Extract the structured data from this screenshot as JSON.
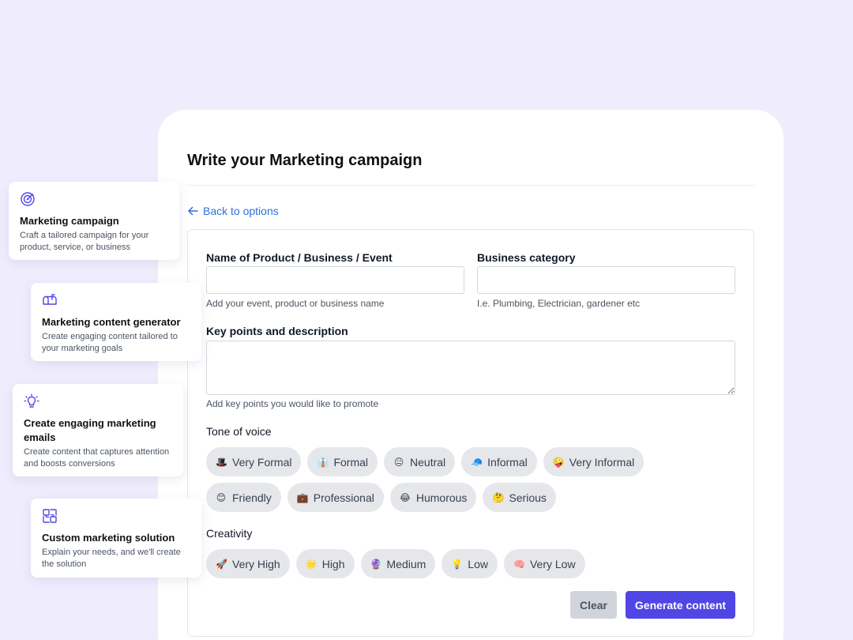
{
  "main": {
    "title": "Write your Marketing campaign",
    "back_link": "Back to options"
  },
  "form": {
    "name_field": {
      "label": "Name of Product / Business / Event",
      "value": "",
      "help": "Add your event, product or business name"
    },
    "category_field": {
      "label": "Business category",
      "value": "",
      "help": "I.e. Plumbing, Electrician, gardener etc"
    },
    "keypoints_field": {
      "label": "Key points and description",
      "value": "",
      "help": "Add key points you would like to promote"
    },
    "tone": {
      "label": "Tone of voice",
      "options": [
        {
          "emoji": "🎩",
          "label": "Very Formal"
        },
        {
          "emoji": "👔",
          "label": "Formal"
        },
        {
          "emoji": "😐",
          "label": "Neutral"
        },
        {
          "emoji": "🧢",
          "label": "Informal"
        },
        {
          "emoji": "🤪",
          "label": "Very Informal"
        },
        {
          "emoji": "😊",
          "label": "Friendly"
        },
        {
          "emoji": "💼",
          "label": "Professional"
        },
        {
          "emoji": "😂",
          "label": "Humorous"
        },
        {
          "emoji": "🤔",
          "label": "Serious"
        }
      ]
    },
    "creativity": {
      "label": "Creativity",
      "options": [
        {
          "emoji": "🚀",
          "label": "Very High"
        },
        {
          "emoji": "🌟",
          "label": "High"
        },
        {
          "emoji": "🔮",
          "label": "Medium"
        },
        {
          "emoji": "💡",
          "label": "Low"
        },
        {
          "emoji": "🧠",
          "label": "Very Low"
        }
      ]
    },
    "clear_label": "Clear",
    "generate_label": "Generate content"
  },
  "sidebar": {
    "cards": [
      {
        "icon": "target-icon",
        "title": "Marketing campaign",
        "desc": "Craft a tailored campaign for your product, service, or business"
      },
      {
        "icon": "mailbox-icon",
        "title": "Marketing content generator",
        "desc": "Create engaging content tailored to your marketing goals"
      },
      {
        "icon": "lightbulb-icon",
        "title": "Create engaging marketing emails",
        "desc": "Create content that captures attention and boosts conversions"
      },
      {
        "icon": "puzzle-icon",
        "title": "Custom marketing solution",
        "desc": "Explain your needs, and we'll create the solution"
      }
    ]
  },
  "colors": {
    "background": "#efedfd",
    "accent": "#4f46e5",
    "link": "#2f6fdc",
    "chip": "#e6e7ea"
  }
}
